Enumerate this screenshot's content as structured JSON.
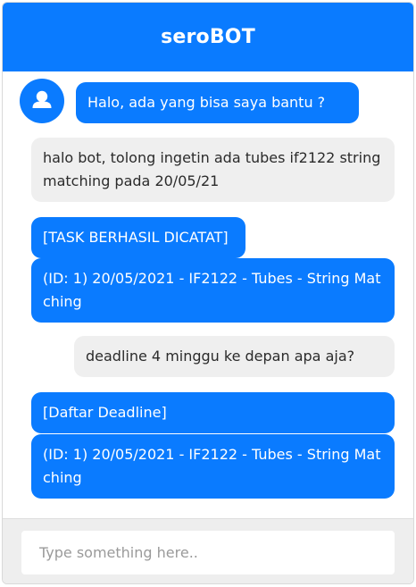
{
  "header": {
    "title": "seroBOT"
  },
  "colors": {
    "accent": "#0a7bff",
    "user_bubble": "#efefef",
    "footer": "#eeeeee"
  },
  "avatar": {
    "icon": "user-icon"
  },
  "messages": [
    {
      "sender": "bot",
      "text": "Halo, ada yang bisa saya bantu ?"
    },
    {
      "sender": "user",
      "text": "halo bot, tolong ingetin ada tubes if2122 string matching pada 20/05/21"
    },
    {
      "sender": "bot",
      "text": "[TASK BERHASIL DICATAT]"
    },
    {
      "sender": "bot",
      "text": "(ID: 1) 20/05/2021 - IF2122 - Tubes - String Matching"
    },
    {
      "sender": "user",
      "text": "deadline 4 minggu ke depan apa aja?"
    },
    {
      "sender": "bot",
      "text": "[Daftar Deadline]"
    },
    {
      "sender": "bot",
      "text": "(ID: 1) 20/05/2021 - IF2122 - Tubes - String Matching"
    }
  ],
  "input": {
    "placeholder": "Type something here..",
    "value": ""
  }
}
